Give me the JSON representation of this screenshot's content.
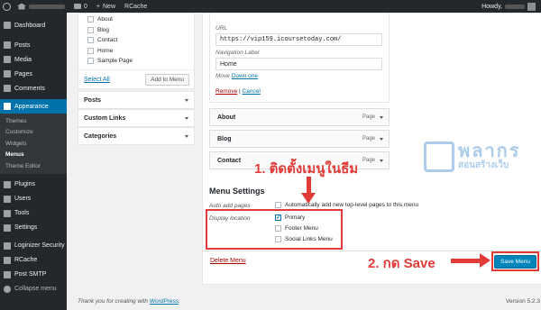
{
  "admin_bar": {
    "comments_count": "0",
    "new_label": "New",
    "rcache_label": "RCache",
    "howdy": "Howdy,"
  },
  "sidebar": {
    "items": [
      {
        "label": "Dashboard",
        "icon": "dashboard-icon"
      },
      {
        "label": "Posts",
        "icon": "pin-icon"
      },
      {
        "label": "Media",
        "icon": "media-icon"
      },
      {
        "label": "Pages",
        "icon": "pages-icon"
      },
      {
        "label": "Comments",
        "icon": "comment-icon"
      },
      {
        "label": "Appearance",
        "icon": "brush-icon"
      }
    ],
    "submenu": [
      "Themes",
      "Customize",
      "Widgets",
      "Menus",
      "Theme Editor"
    ],
    "items_after": [
      {
        "label": "Plugins",
        "icon": "plugin-icon"
      },
      {
        "label": "Users",
        "icon": "users-icon"
      },
      {
        "label": "Tools",
        "icon": "tools-icon"
      },
      {
        "label": "Settings",
        "icon": "settings-icon"
      },
      {
        "label": "Loginizer Security",
        "icon": "gear-icon"
      },
      {
        "label": "RCache",
        "icon": "gear-icon"
      },
      {
        "label": "Post SMTP",
        "icon": "gear-icon"
      },
      {
        "label": "Collapse menu",
        "icon": "collapse-icon"
      }
    ]
  },
  "pages_box": {
    "items": [
      "About",
      "Blog",
      "Contact",
      "Home",
      "Sample Page"
    ],
    "select_all": "Select All",
    "add_button": "Add to Menu"
  },
  "accordions": [
    "Posts",
    "Custom Links",
    "Categories"
  ],
  "expanded_item": {
    "url_label": "URL",
    "url_value": "https://vip159.icoursetoday.com/",
    "nav_label": "Navigation Label",
    "nav_value": "Home",
    "move_label": "Move",
    "move_link": "Down one",
    "remove": "Remove",
    "separator": "|",
    "cancel": "Cancel"
  },
  "menu_items": [
    {
      "title": "About",
      "type": "Page"
    },
    {
      "title": "Blog",
      "type": "Page"
    },
    {
      "title": "Contact",
      "type": "Page"
    }
  ],
  "menu_settings": {
    "title": "Menu Settings",
    "auto_add_label": "Auto add pages",
    "auto_add_text": "Automatically add new top-level pages to this menu",
    "display_location_label": "Display location",
    "locations": [
      "Primary",
      "Footer Menu",
      "Social Links Menu"
    ]
  },
  "delete_menu": "Delete Menu",
  "save_menu": "Save Menu",
  "annotations": {
    "step1": "1. ติดตั้งเมนูในธีม",
    "step2": "2. กด Save"
  },
  "watermark": {
    "line1": "พลากร",
    "line2": "สอนสร้างเว็บ"
  },
  "footer": {
    "thanks_prefix": "Thank you for creating with ",
    "thanks_link": "WordPress",
    "thanks_suffix": ".",
    "version": "Version 5.2.3"
  },
  "colors": {
    "accent": "#0073aa",
    "annotation": "#e23a36",
    "sidebar_bg": "#23282d"
  }
}
